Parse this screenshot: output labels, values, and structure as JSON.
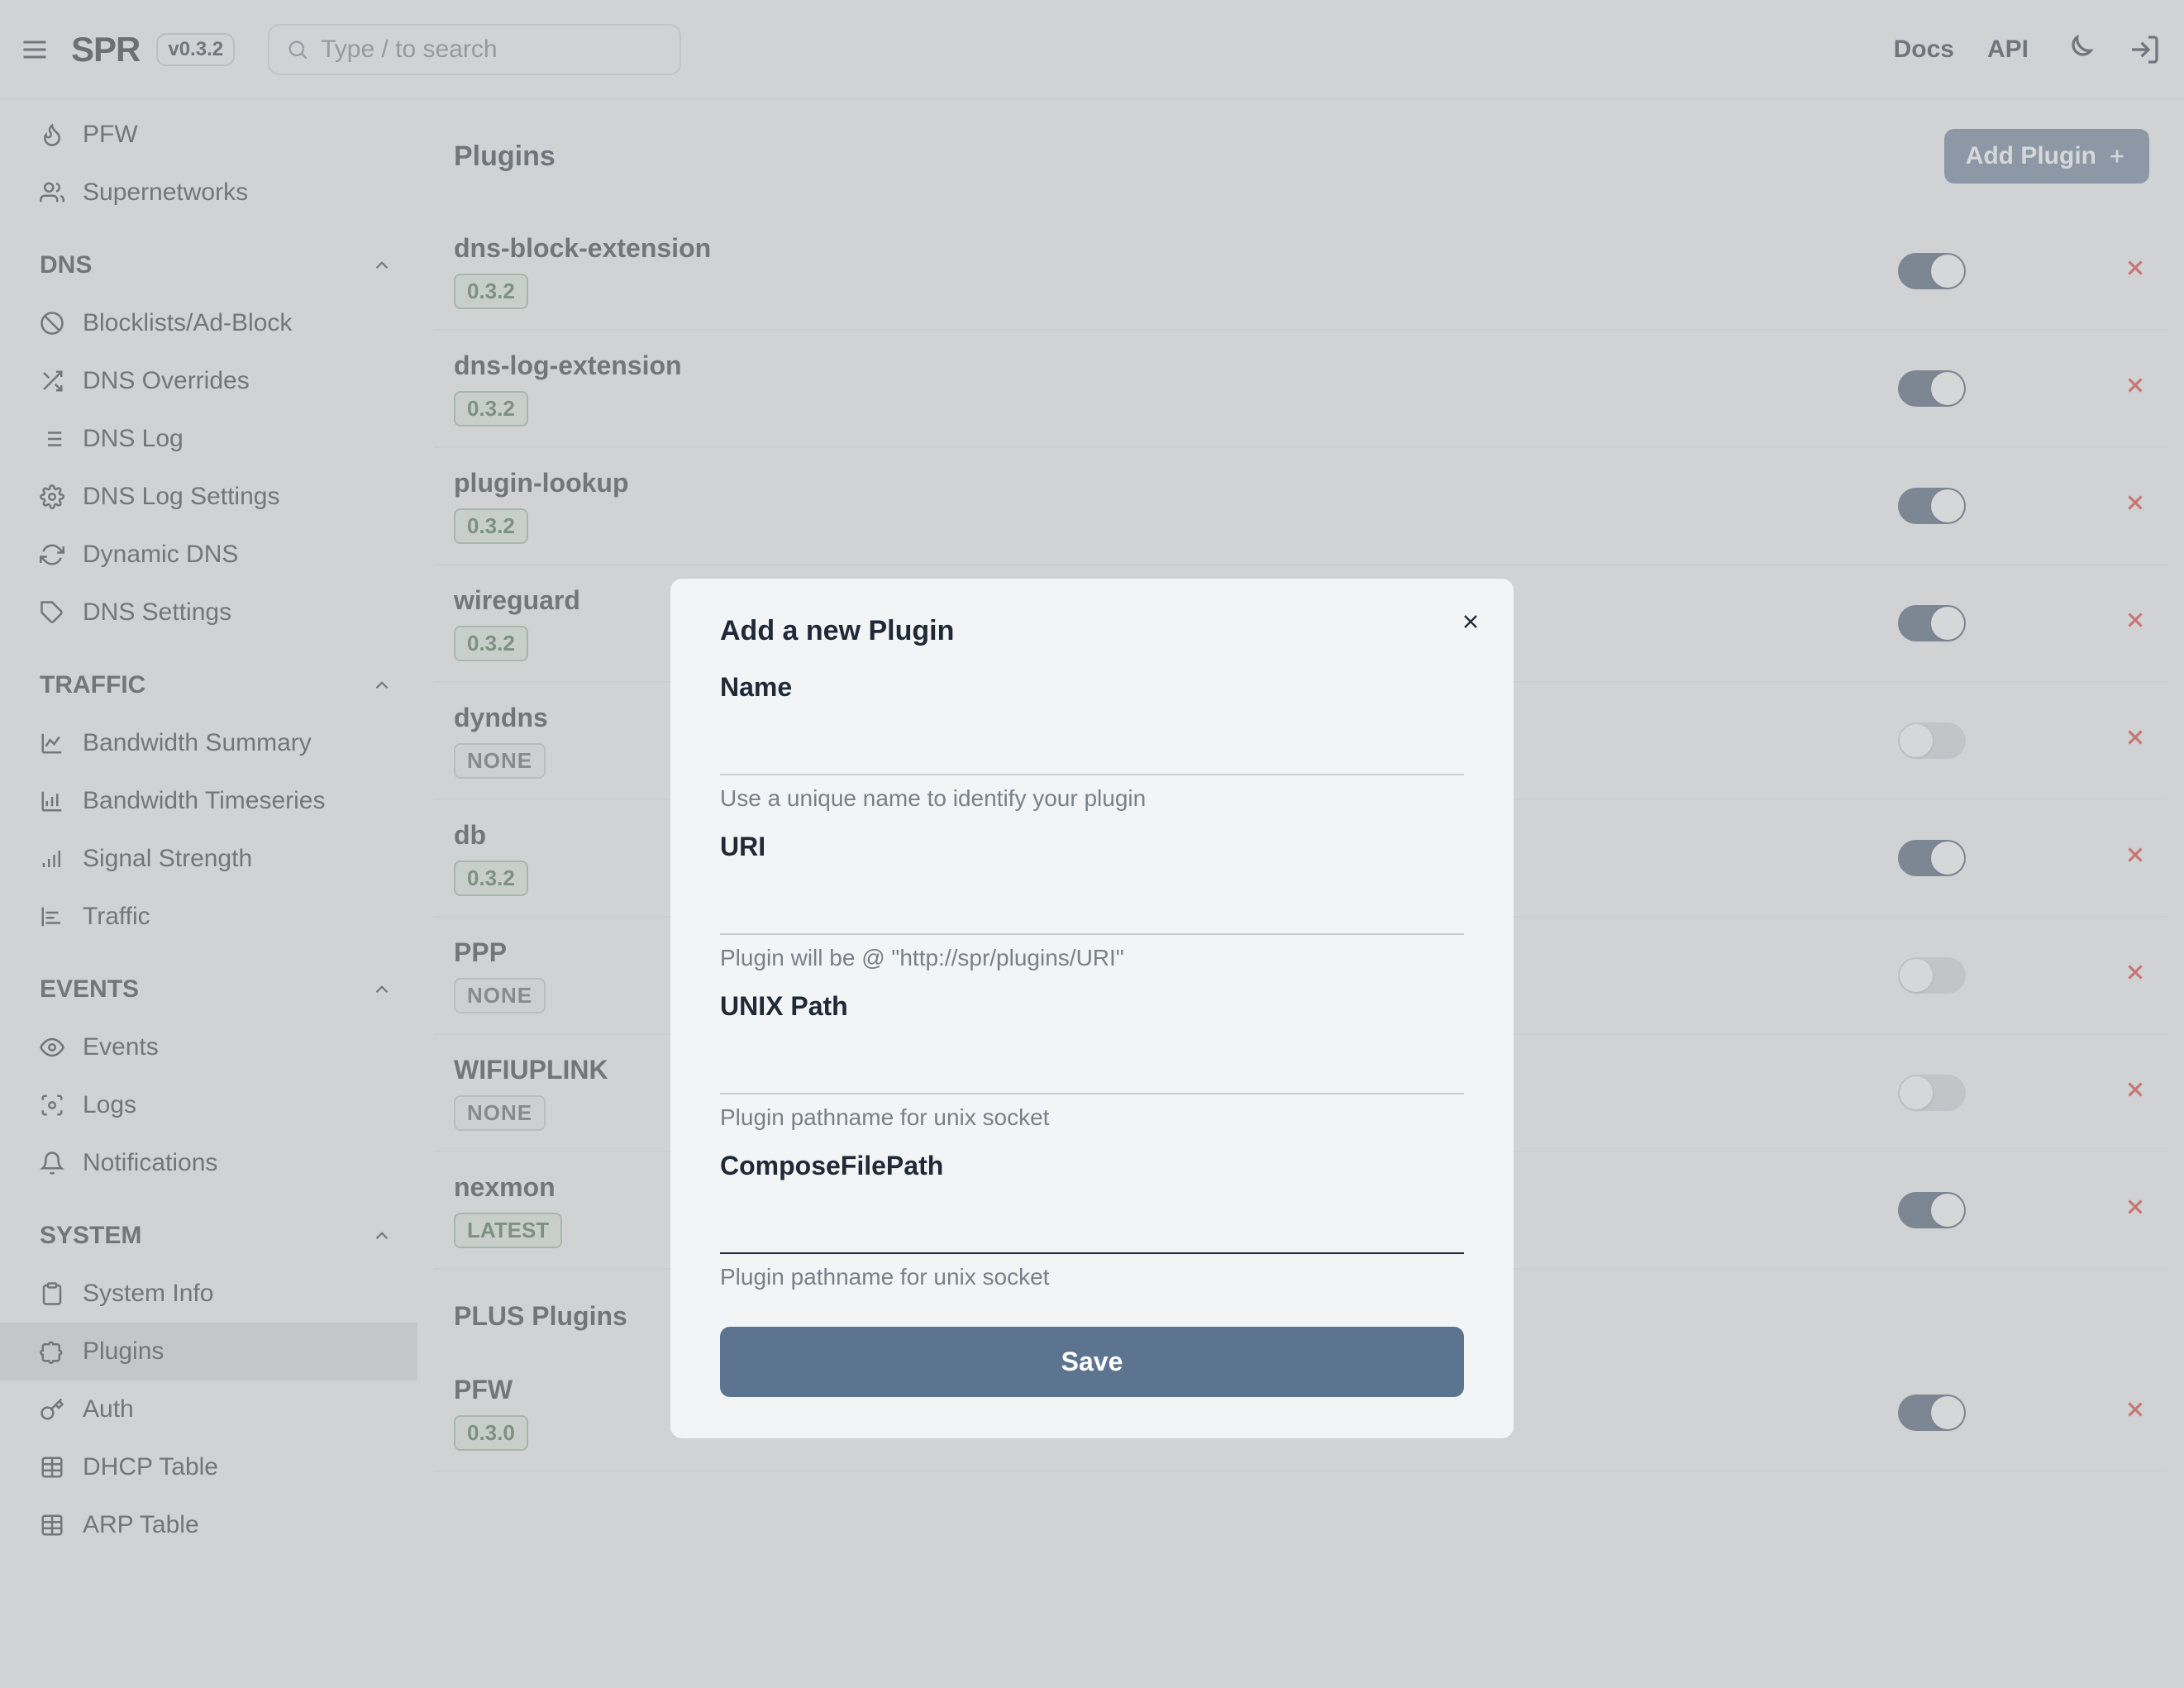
{
  "header": {
    "logo": "SPR",
    "version": "v0.3.2",
    "search_placeholder": "Type / to search",
    "links": {
      "docs": "Docs",
      "api": "API"
    }
  },
  "sidebar": {
    "top_items": [
      {
        "label": "PFW",
        "icon": "flame"
      },
      {
        "label": "Supernetworks",
        "icon": "users"
      }
    ],
    "groups": [
      {
        "label": "DNS",
        "items": [
          {
            "label": "Blocklists/Ad-Block",
            "icon": "ban"
          },
          {
            "label": "DNS Overrides",
            "icon": "shuffle"
          },
          {
            "label": "DNS Log",
            "icon": "list"
          },
          {
            "label": "DNS Log Settings",
            "icon": "gear"
          },
          {
            "label": "Dynamic DNS",
            "icon": "refresh"
          },
          {
            "label": "DNS Settings",
            "icon": "tag"
          }
        ]
      },
      {
        "label": "TRAFFIC",
        "items": [
          {
            "label": "Bandwidth Summary",
            "icon": "chart-line"
          },
          {
            "label": "Bandwidth Timeseries",
            "icon": "chart-bar"
          },
          {
            "label": "Signal Strength",
            "icon": "signal"
          },
          {
            "label": "Traffic",
            "icon": "bars-h"
          }
        ]
      },
      {
        "label": "EVENTS",
        "items": [
          {
            "label": "Events",
            "icon": "eye"
          },
          {
            "label": "Logs",
            "icon": "scan"
          },
          {
            "label": "Notifications",
            "icon": "bell"
          }
        ]
      },
      {
        "label": "SYSTEM",
        "items": [
          {
            "label": "System Info",
            "icon": "clipboard"
          },
          {
            "label": "Plugins",
            "icon": "puzzle",
            "active": true
          },
          {
            "label": "Auth",
            "icon": "key"
          },
          {
            "label": "DHCP Table",
            "icon": "table"
          },
          {
            "label": "ARP Table",
            "icon": "table"
          }
        ]
      }
    ]
  },
  "page": {
    "title": "Plugins",
    "add_button": "Add Plugin",
    "plus_section": "PLUS Plugins",
    "plugins": [
      {
        "name": "dns-block-extension",
        "badge": "0.3.2",
        "on": true
      },
      {
        "name": "dns-log-extension",
        "badge": "0.3.2",
        "on": true
      },
      {
        "name": "plugin-lookup",
        "badge": "0.3.2",
        "on": true
      },
      {
        "name": "wireguard",
        "badge": "0.3.2",
        "on": true
      },
      {
        "name": "dyndns",
        "badge": "NONE",
        "on": false
      },
      {
        "name": "db",
        "badge": "0.3.2",
        "on": true
      },
      {
        "name": "PPP",
        "badge": "NONE",
        "on": false
      },
      {
        "name": "WIFIUPLINK",
        "badge": "NONE",
        "on": false
      },
      {
        "name": "nexmon",
        "badge": "LATEST",
        "on": true
      }
    ],
    "plus_plugins": [
      {
        "name": "PFW",
        "badge": "0.3.0",
        "on": true
      }
    ]
  },
  "modal": {
    "title": "Add a new Plugin",
    "fields": {
      "name": {
        "label": "Name",
        "help": "Use a unique name to identify your plugin"
      },
      "uri": {
        "label": "URI",
        "help": "Plugin will be @ \"http://spr/plugins/URI\""
      },
      "unix": {
        "label": "UNIX Path",
        "help": "Plugin pathname for unix socket"
      },
      "compose": {
        "label": "ComposeFilePath",
        "help": "Plugin pathname for unix socket"
      }
    },
    "save": "Save"
  }
}
